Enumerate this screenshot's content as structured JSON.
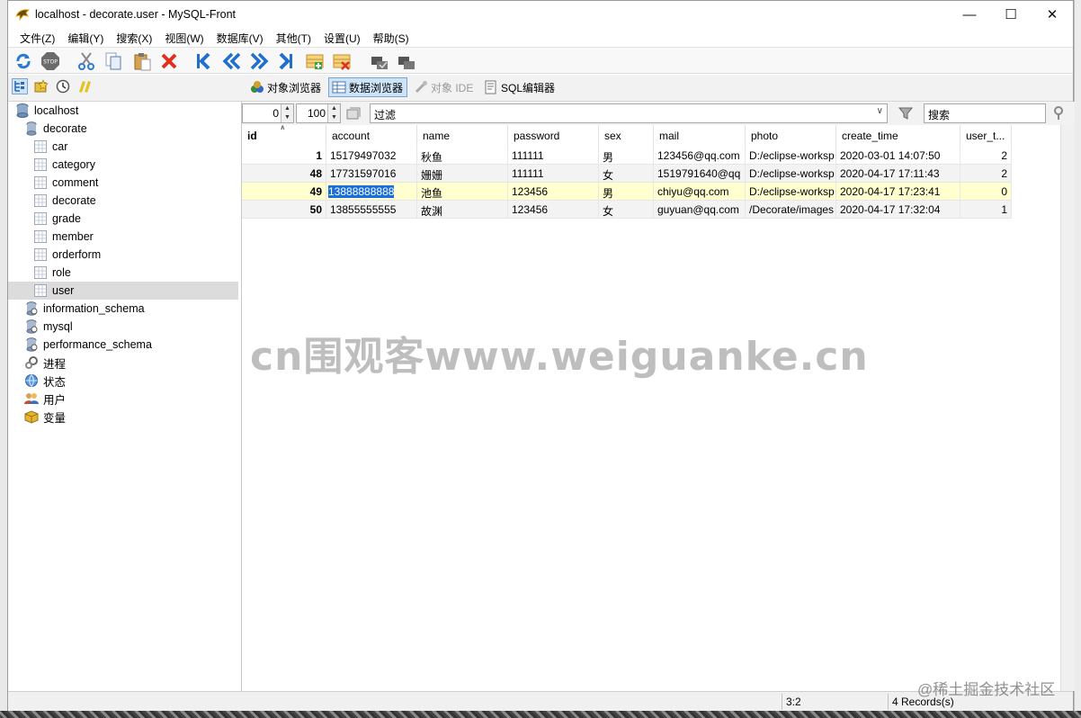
{
  "window": {
    "title": "localhost - decorate.user - MySQL-Front"
  },
  "menu": [
    "文件(Z)",
    "编辑(Y)",
    "搜索(X)",
    "视图(W)",
    "数据库(V)",
    "其他(T)",
    "设置(U)",
    "帮助(S)"
  ],
  "tabs": {
    "object_browser": "对象浏览器",
    "data_browser": "数据浏览器",
    "object_ide": "对象 IDE",
    "sql_editor": "SQL编辑器"
  },
  "tree": {
    "root": "localhost",
    "db_open": "decorate",
    "tables": [
      "car",
      "category",
      "comment",
      "decorate",
      "grade",
      "member",
      "orderform",
      "role",
      "user"
    ],
    "other_dbs": [
      "information_schema",
      "mysql",
      "performance_schema"
    ],
    "extras": [
      "进程",
      "状态",
      "用户",
      "变量"
    ]
  },
  "filter": {
    "offset": "0",
    "limit": "100",
    "filter_placeholder": "过滤",
    "search_placeholder": "搜索"
  },
  "grid": {
    "columns": [
      "id",
      "account",
      "name",
      "password",
      "sex",
      "mail",
      "photo",
      "create_time",
      "user_t..."
    ],
    "rows": [
      [
        "1",
        "15179497032",
        "秋鱼",
        "111111",
        "男",
        "123456@qq.com",
        "D:/eclipse-worksp",
        "2020-03-01 14:07:50",
        "2"
      ],
      [
        "48",
        "17731597016",
        "姗姗",
        "111111",
        "女",
        "1519791640@qq",
        "D:/eclipse-worksp",
        "2020-04-17 17:11:43",
        "2"
      ],
      [
        "49",
        "13888888888",
        "池鱼",
        "123456",
        "男",
        "chiyu@qq.com",
        "D:/eclipse-worksp",
        "2020-04-17 17:23:41",
        "0"
      ],
      [
        "50",
        "13855555555",
        "故渊",
        "123456",
        "女",
        "guyuan@qq.com",
        "/Decorate/images",
        "2020-04-17 17:32:04",
        "1"
      ]
    ]
  },
  "status": {
    "position": "3:2",
    "records": "4 Records(s)"
  },
  "watermark": "cn围观客www.weiguanke.cn",
  "watermark2": "@稀土掘金技术社区",
  "colors": {
    "selected_row": "#ffffd0",
    "alt_row": "#f3f3f3",
    "selection": "#1a6ed8"
  }
}
